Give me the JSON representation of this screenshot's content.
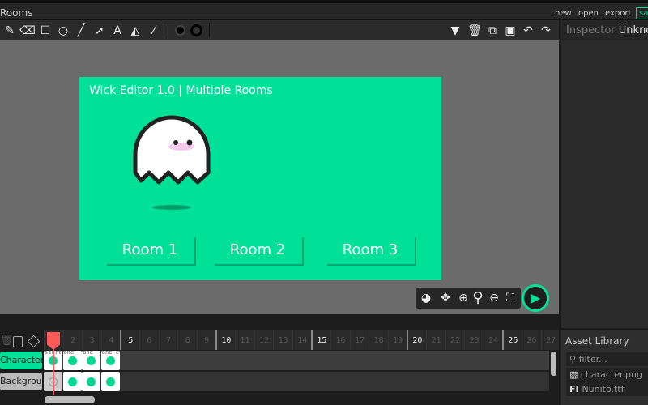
{
  "header": {
    "title": "Rooms",
    "menu": [
      "new",
      "open",
      "export"
    ],
    "save": "sav"
  },
  "toolbar": {
    "tools": [
      "pencil-icon",
      "eraser-icon",
      "rectangle-icon",
      "ellipse-icon",
      "line-icon",
      "path-cursor-icon",
      "text-icon",
      "fill-bucket-icon",
      "eyedropper-icon"
    ],
    "fill_color": "#000000",
    "stroke_color": "#000000"
  },
  "stage": {
    "title": "Wick Editor 1.0 | Multiple Rooms",
    "background": "#00e096",
    "buttons": [
      {
        "label": "Room 1",
        "color": "#ff5f0f"
      },
      {
        "label": "Room 2",
        "color": "#d400e0"
      },
      {
        "label": "Room 3",
        "color": "#0a14d8"
      }
    ]
  },
  "inspector": {
    "title": "Inspector",
    "selection": "Unknown"
  },
  "assets": {
    "title": "Asset Library",
    "filter_placeholder": "filter...",
    "items": [
      {
        "icon": "image-icon",
        "name": "character.png"
      },
      {
        "icon": "font-icon",
        "name": "Nunito.ttf"
      }
    ]
  },
  "timeline": {
    "frame_numbers": [
      1,
      2,
      3,
      4,
      5,
      6,
      7,
      8,
      9,
      10,
      11,
      12,
      13,
      14,
      15,
      16,
      17,
      18,
      19,
      20,
      21,
      22,
      23,
      24,
      25,
      26,
      27
    ],
    "layers": [
      {
        "name": "Character",
        "active": true,
        "frames": [
          {
            "label": "start",
            "filled": true
          },
          {
            "label": "one",
            "filled": true
          },
          {
            "label": "one",
            "filled": true
          },
          {
            "label": "one c",
            "filled": true
          }
        ]
      },
      {
        "name": "Background",
        "active": false,
        "frames": [
          {
            "label": "",
            "filled": false
          },
          {
            "label": "",
            "filled": true
          },
          {
            "label": "",
            "filled": true
          },
          {
            "label": "",
            "filled": true
          }
        ]
      }
    ]
  }
}
